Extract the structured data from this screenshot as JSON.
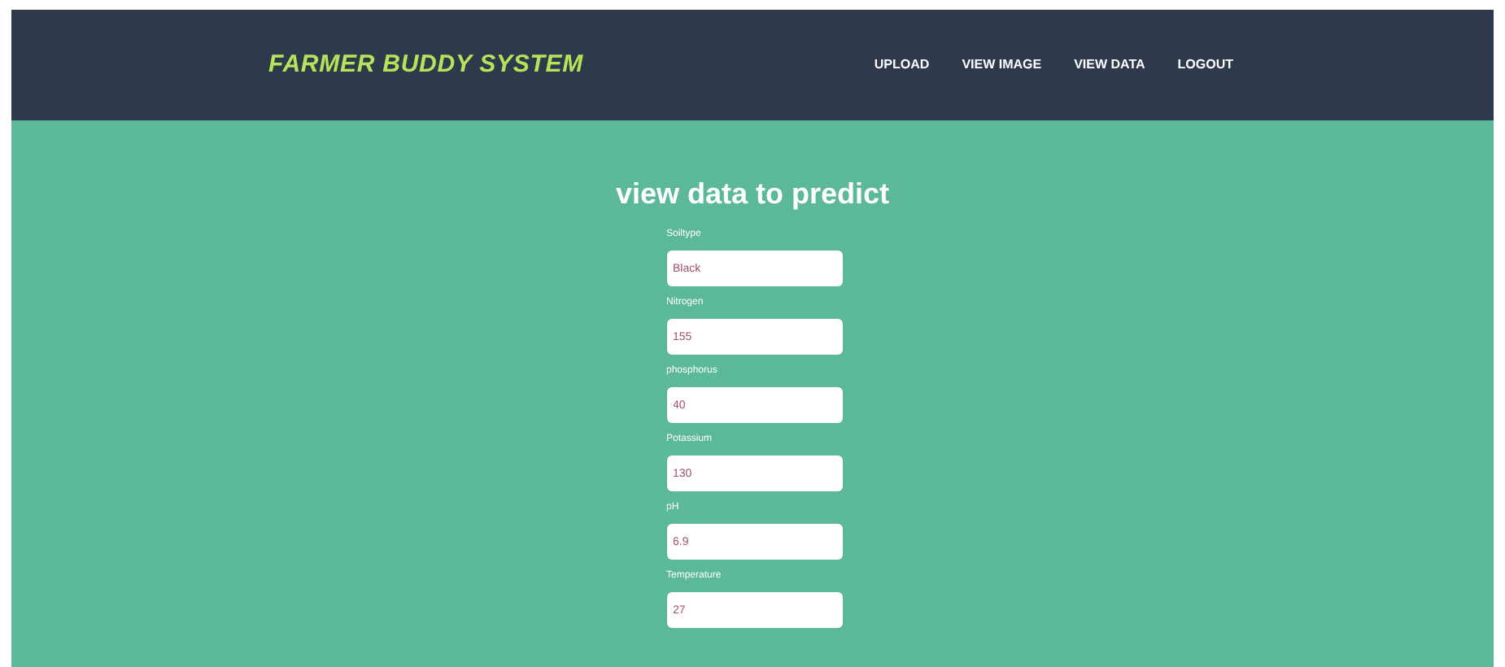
{
  "brand": "FARMER BUDDY SYSTEM",
  "nav": [
    "UPLOAD",
    "VIEW IMAGE",
    "VIEW DATA",
    "LOGOUT"
  ],
  "title": "view data to predict",
  "fields": [
    {
      "label": "Soiltype",
      "value": "Black"
    },
    {
      "label": "Nitrogen",
      "value": "155"
    },
    {
      "label": "phosphorus",
      "value": "40"
    },
    {
      "label": "Potassium",
      "value": "130"
    },
    {
      "label": "pH",
      "value": "6.9"
    },
    {
      "label": "Temperature",
      "value": "27"
    }
  ]
}
